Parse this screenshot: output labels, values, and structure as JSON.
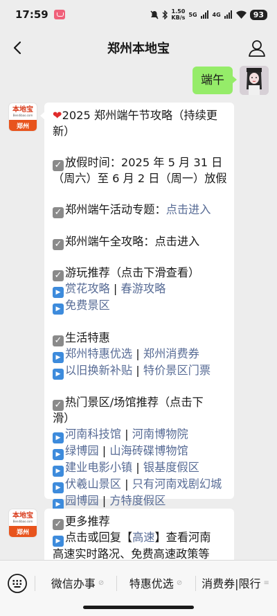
{
  "status": {
    "time": "17:59",
    "net_top": "1.50",
    "net_bottom": "KB/s",
    "sig1": "5G",
    "sig2": "4G",
    "battery": "93"
  },
  "nav": {
    "title": "郑州本地宝"
  },
  "outgoing": {
    "text": "端午"
  },
  "bot": {
    "logo_text": "本地宝",
    "logo_sub": "Bendibao.com",
    "logo_city": "郑州"
  },
  "msg1": {
    "title_1": "2025 郑州端午节攻略（持续更",
    "title_2": "新）",
    "holiday_1": "放假时间：2025 年 5 月 31 日",
    "holiday_2": "（周六）至 6 月 2 日（周一）放假",
    "activity_label": "郑州端午活动专题：",
    "activity_link": "点击进入",
    "guide": "郑州端午全攻略：点击进入",
    "play_title": "游玩推荐（点击下滑查看）",
    "play_links": [
      "赏花攻略",
      "春游攻略",
      "免费景区"
    ],
    "life_title": "生活特惠",
    "life_links": [
      "郑州特惠优选",
      "郑州消费券",
      "以旧换新补贴",
      "特价景区门票"
    ],
    "hot_title_1": "热门景区/场馆推荐（点击下",
    "hot_title_2": "滑）",
    "hot_links": [
      "河南科技馆",
      "河南博物院",
      "绿博园",
      "山海砖碟博物馆",
      "建业电影小镇",
      "银基度假区",
      "伏羲山景区",
      "只有河南戏剧幻城",
      "园博园",
      "方特度假区"
    ],
    "separator": "|"
  },
  "msg2": {
    "more_title": "更多推荐",
    "reply_1a": "点击或回复【",
    "reply_1b": "高速",
    "reply_1c": "】查看河南",
    "reply_2": "高速实时路况、免费高速政策等"
  },
  "menu": {
    "items": [
      "微信办事",
      "特惠优选",
      "消费券|限行"
    ],
    "more": "≡"
  }
}
